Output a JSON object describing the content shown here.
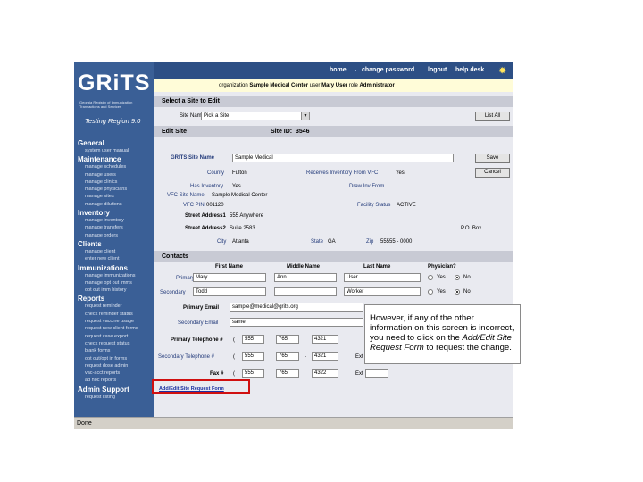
{
  "app": {
    "logo": "GRiTS",
    "logo_sub": "Georgia Registry of Immunization Transactions and Services",
    "region": "Testing Region 9.0"
  },
  "topnav": [
    "home",
    "change password",
    "logout",
    "help desk"
  ],
  "userbar": {
    "organization_label": "organization",
    "organization": "Sample Medical Center",
    "user_label": "user",
    "user": "Mary User",
    "role_label": "role",
    "role": "Administrator"
  },
  "sidebar": [
    {
      "header": "General",
      "items": [
        "system user manual"
      ]
    },
    {
      "header": "Maintenance",
      "items": [
        "manage schedules",
        "manage users",
        "manage clinics",
        "manage physicians",
        "manage sites",
        "manage dilutions"
      ]
    },
    {
      "header": "Inventory",
      "items": [
        "manage inventory",
        "manage transfers",
        "manage orders"
      ]
    },
    {
      "header": "Clients",
      "items": [
        "manage client",
        "enter new client"
      ]
    },
    {
      "header": "Immunizations",
      "items": [
        "manage immunizations",
        "manage opt out imms",
        "opt out imm history"
      ]
    },
    {
      "header": "Reports",
      "items": [
        "request reminder",
        "check reminder status",
        "request vaccine usage",
        "request new client forms",
        "request case export",
        "check request status",
        "blank forms",
        "opt out/opt in forms",
        "request dose admin",
        "vac-acct reports",
        "ad hoc reports"
      ]
    },
    {
      "header": "Admin Support",
      "items": [
        "request listing"
      ]
    }
  ],
  "select_site": {
    "header": "Select a Site to Edit",
    "site_name_label": "Site Name",
    "site_name_value": "Pick a Site",
    "list_all": "List All"
  },
  "edit_site": {
    "header": "Edit Site",
    "site_id_label": "Site ID:",
    "site_id": "3546",
    "grits_site_name_label": "GRITS Site Name",
    "grits_site_name": "Sample Medical",
    "save": "Save",
    "cancel": "Cancel",
    "county_label": "County",
    "county": "Fulton",
    "receives_inventory_label": "Receives Inventory From VFC",
    "receives_inventory": "Yes",
    "has_inventory_label": "Has Inventory",
    "has_inventory": "Yes",
    "draw_inv_label": "Draw Inv From",
    "vfc_site_name_label": "VFC Site Name",
    "vfc_site_name": "Sample Medical Center",
    "vfc_pin_label": "VFC PIN",
    "vfc_pin": "001120",
    "facility_status_label": "Facility Status",
    "facility_status": "ACTIVE",
    "street1_label": "Street Address1",
    "street1": "555 Anywhere",
    "street2_label": "Street Address2",
    "street2": "Suite 2583",
    "po_box_label": "P.O. Box",
    "city_label": "City",
    "city": "Atlanta",
    "state_label": "State",
    "state": "GA",
    "zip_label": "Zip",
    "zip": "55555 - 0000"
  },
  "contacts": {
    "header": "Contacts",
    "col_first": "First Name",
    "col_middle": "Middle Name",
    "col_last": "Last Name",
    "col_physician": "Physician?",
    "primary_label": "Primary",
    "primary_first": "Mary",
    "primary_middle": "Ann",
    "primary_last": "User",
    "secondary_label": "Secondary",
    "secondary_first": "Todd",
    "secondary_middle": "",
    "secondary_last": "Worker",
    "yes": "Yes",
    "no": "No",
    "primary_email_label": "Primary Email",
    "primary_email": "sample@medical@grits.org",
    "secondary_email_label": "Secondary Email",
    "secondary_email": "same",
    "primary_phone_label": "Primary Telephone #",
    "primary_phone": [
      "555",
      "765",
      "4321"
    ],
    "secondary_phone_label": "Secondary Telephone #",
    "secondary_phone": [
      "555",
      "765",
      "4321"
    ],
    "fax_label": "Fax #",
    "fax": [
      "555",
      "765",
      "4322"
    ],
    "ext_label": "Ext",
    "request_link": "Add/Edit Site Request Form"
  },
  "status": "Done",
  "callout": {
    "line1": "However, if any of the other information on this screen is incorrect, you need to click on the",
    "link": "Add/Edit Site Request Form",
    "line2": "to request the change."
  }
}
